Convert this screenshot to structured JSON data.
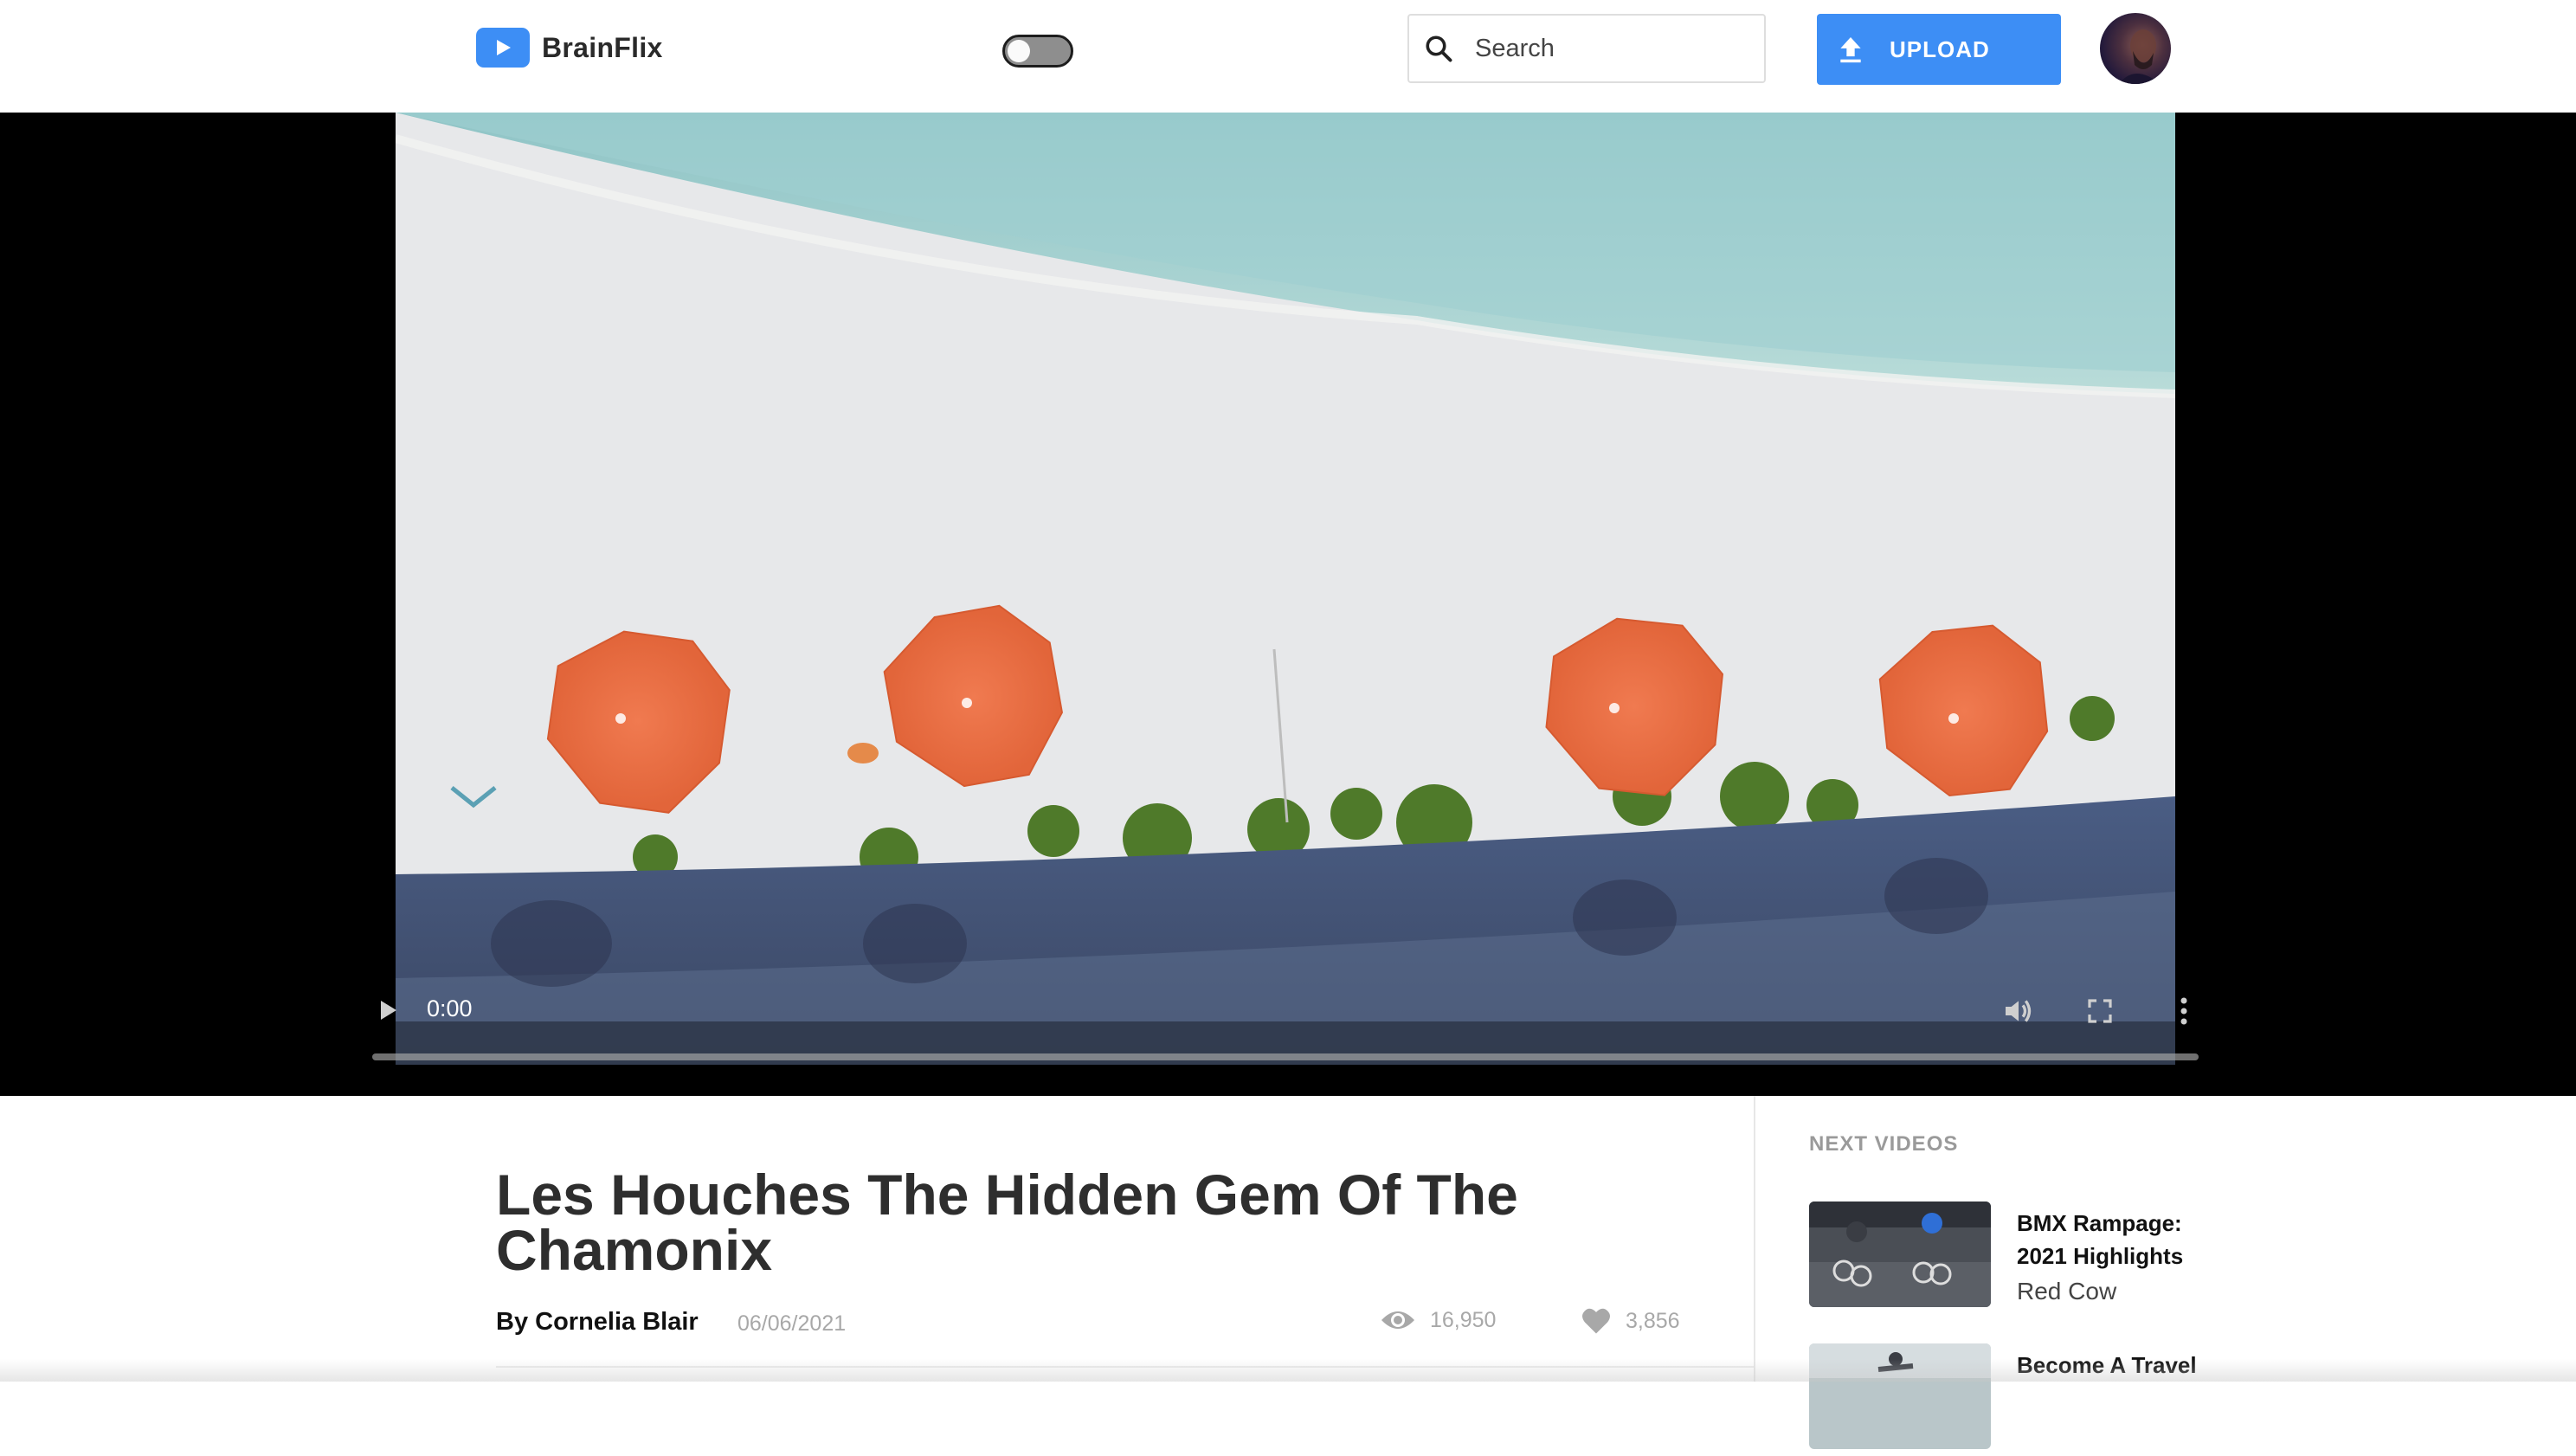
{
  "app": {
    "name": "BrainFlix",
    "accent_color": "#3d8ef5"
  },
  "header": {
    "theme_toggle_state": "off",
    "search_placeholder": "Search",
    "upload_label": "UPLOAD",
    "avatar_icon": "user-avatar-icon"
  },
  "player": {
    "current_time": "0:00",
    "progress_fraction": 0,
    "icons": [
      "play-icon",
      "volume-icon",
      "fullscreen-icon",
      "more-vertical-icon"
    ]
  },
  "video": {
    "title": "Les Houches The Hidden Gem Of The Chamonix",
    "author": "By Cornelia Blair",
    "date": "06/06/2021",
    "views": "16,950",
    "likes": "3,856"
  },
  "next_videos": {
    "heading": "NEXT VIDEOS",
    "items": [
      {
        "title": "BMX Rampage: 2021 Highlights",
        "channel": "Red Cow"
      },
      {
        "title": "Become A Travel",
        "channel": ""
      }
    ]
  }
}
